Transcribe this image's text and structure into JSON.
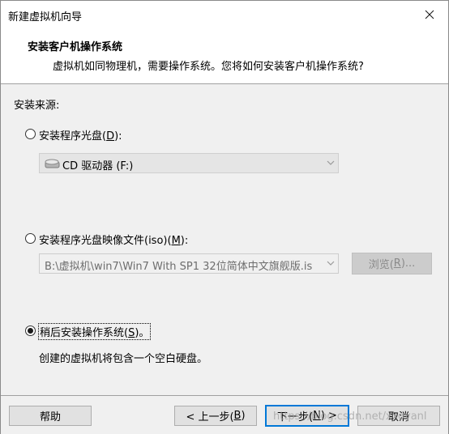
{
  "window": {
    "title": "新建虚拟机向导"
  },
  "header": {
    "title": "安装客户机操作系统",
    "subtitle": "虚拟机如同物理机，需要操作系统。您将如何安装客户机操作系统?"
  },
  "install_source": {
    "label": "安装来源:",
    "options": [
      {
        "label_prefix": "安装程序光盘(",
        "mnemonic": "D",
        "label_suffix": "):",
        "selected": false
      },
      {
        "label_prefix": "安装程序光盘映像文件(iso)(",
        "mnemonic": "M",
        "label_suffix": "):",
        "selected": false
      },
      {
        "label_prefix": "稍后安装操作系统(",
        "mnemonic": "S",
        "label_suffix": ")。",
        "selected": true
      }
    ],
    "disc_drive": {
      "value": "CD 驱动器 (F:)",
      "icon": "cd-drive-icon"
    },
    "iso_path": {
      "value": "B:\\虚拟机\\win7\\Win7 With SP1 32位简体中文旗舰版.is"
    },
    "browse": {
      "label_prefix": "浏览(",
      "mnemonic": "R",
      "label_suffix": ")..."
    },
    "later_description": "创建的虚拟机将包含一个空白硬盘。"
  },
  "footer": {
    "help": "帮助",
    "back": {
      "label_prefix": "< 上一步(",
      "mnemonic": "B",
      "label_suffix": ")"
    },
    "next": {
      "label_prefix": "下一步(",
      "mnemonic": "N",
      "label_suffix": ") >"
    },
    "cancel": "取消"
  },
  "watermark": "https://blog.csdn.net/xxoyanl"
}
